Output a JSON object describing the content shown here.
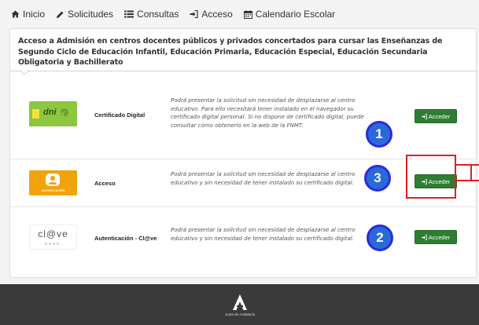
{
  "nav": {
    "items": [
      {
        "label": "Inicio",
        "icon": "home-icon"
      },
      {
        "label": "Solicitudes",
        "icon": "pencil-icon"
      },
      {
        "label": "Consultas",
        "icon": "list-icon"
      },
      {
        "label": "Acceso",
        "icon": "sign-in-icon"
      },
      {
        "label": "Calendario Escolar",
        "icon": "calendar-icon"
      }
    ]
  },
  "card": {
    "header": "Acceso a Admisión en centros docentes públicos y privados concertados para cursar las Enseñanzas de Segundo Ciclo de Educación Infantil, Educación Primaria, Educación Especial, Educación Secundaria Obligatoria y Bachillerato"
  },
  "rows": [
    {
      "logo_text": "dni",
      "title": "Certificado Digital",
      "desc": "Podrá presentar la solicitud sin necesidad de desplazarse al centro educativo. Para ello necesitará tener instalado en el navegador su certificado digital personal. Si no dispone de certificado digital, puede consultar cómo obtenerlo en la web de la FNMT.",
      "button": "Acceder",
      "badge": "1"
    },
    {
      "logo_text": "AUTENTICACIÓN",
      "title": "Acceso",
      "desc": "Podrá presentar la solicitud sin necesidad de desplazarse al centro educativo y sin necesidad de tener instalado su certificado digital.",
      "button": "Acceder",
      "badge": "3"
    },
    {
      "logo_text": "cl@ve",
      "title": "Autenticación - Cl@ve",
      "desc": "Podrá presentar la solicitud sin necesidad de desplazarse al centro educativo y sin necesidad de tener instalado su certificado digital.",
      "button": "Acceder",
      "badge": "2"
    }
  ],
  "footer": {
    "org": "Junta de Andalucía"
  },
  "colors": {
    "button_green": "#2e7d32",
    "badge_blue": "#2a6ad7",
    "highlight_red": "#e02020",
    "footer_bg": "#3a3a3a",
    "dni_logo_bg": "#8dc63f",
    "auth_logo_bg": "#f0a30a"
  }
}
